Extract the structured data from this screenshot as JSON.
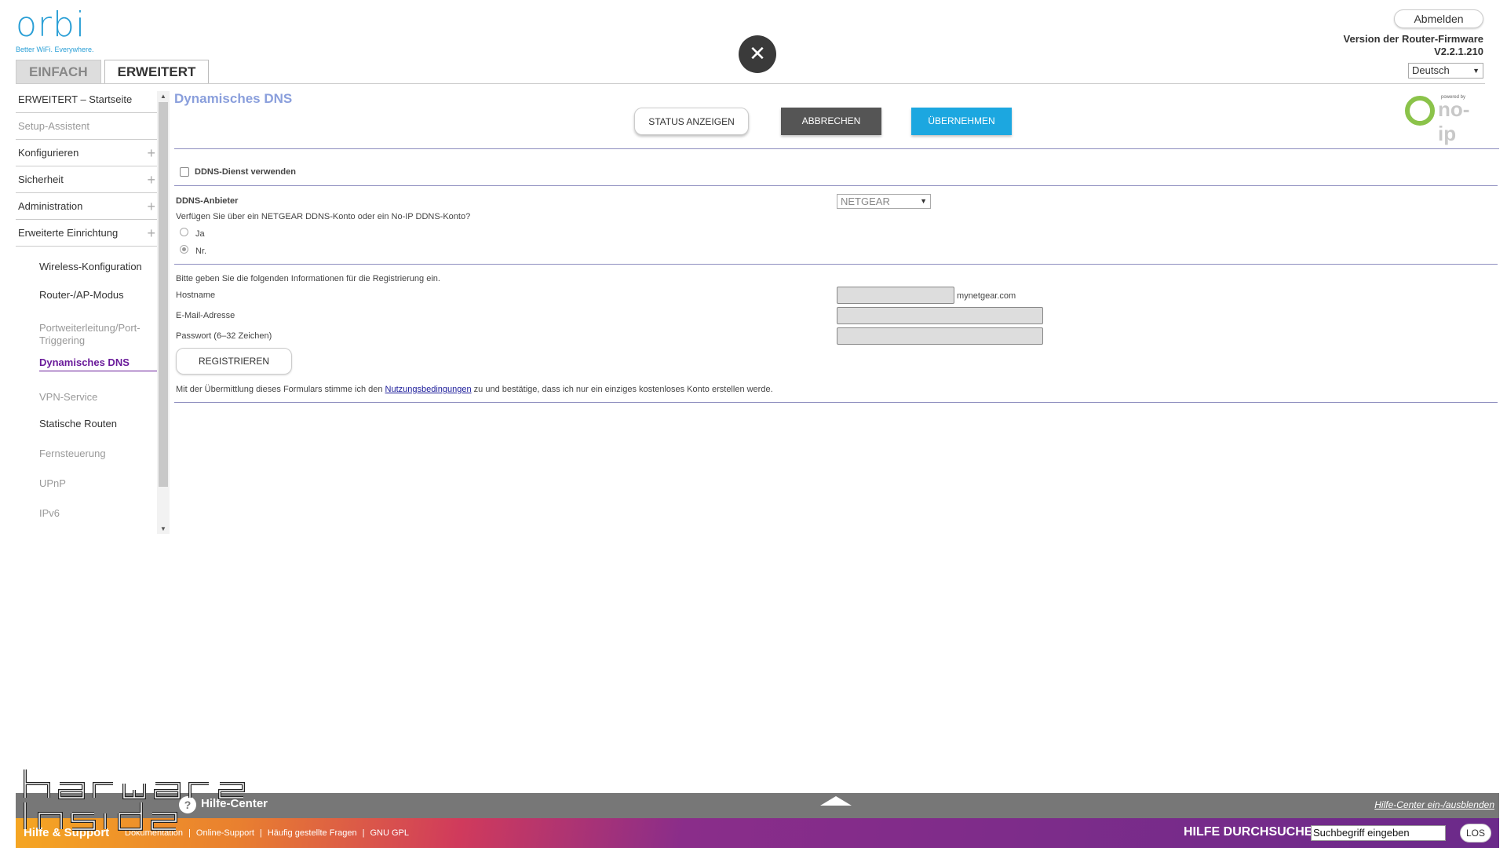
{
  "header": {
    "logo_word": "orbi",
    "logo_tagline": "Better WiFi. Everywhere.",
    "tabs": [
      {
        "label": "EINFACH",
        "active": false
      },
      {
        "label": "ERWEITERT",
        "active": true
      }
    ],
    "close_symbol": "✕",
    "logout_label": "Abmelden",
    "firmware_label": "Version der Router-Firmware",
    "firmware_version": "V2.2.1.210",
    "language": "Deutsch"
  },
  "sidebar": {
    "items": [
      {
        "label": "ERWEITERT – Startseite",
        "muted": false
      },
      {
        "label": "Setup-Assistent",
        "muted": true
      },
      {
        "label": "Konfigurieren",
        "expand": "+"
      },
      {
        "label": "Sicherheit",
        "expand": "+"
      },
      {
        "label": "Administration",
        "expand": "+"
      },
      {
        "label": "Erweiterte Einrichtung",
        "expand": "+"
      }
    ],
    "sub_items": [
      {
        "label": "Wireless-Konfiguration",
        "state": "normal"
      },
      {
        "label": "Router-/AP-Modus",
        "state": "normal"
      },
      {
        "label": "Portweiterleitung/Port-Triggering",
        "state": "muted"
      },
      {
        "label": "Dynamisches DNS",
        "state": "active"
      },
      {
        "label": "VPN-Service",
        "state": "muted"
      },
      {
        "label": "Statische Routen",
        "state": "normal"
      },
      {
        "label": "Fernsteuerung",
        "state": "muted"
      },
      {
        "label": "UPnP",
        "state": "muted"
      },
      {
        "label": "IPv6",
        "state": "muted"
      }
    ]
  },
  "main": {
    "title": "Dynamisches DNS",
    "buttons": {
      "status": "STATUS ANZEIGEN",
      "cancel": "ABBRECHEN",
      "apply": "ÜBERNEHMEN"
    },
    "noip_powered": "powered by",
    "noip_text": "no-ip",
    "use_ddns_label": "DDNS-Dienst verwenden",
    "use_ddns_checked": false,
    "provider_label": "DDNS-Anbieter",
    "provider_value": "NETGEAR",
    "account_question": "Verfügen Sie über ein NETGEAR DDNS-Konto oder ein No-IP DDNS-Konto?",
    "radio_yes": "Ja",
    "radio_no": "Nr.",
    "selected_radio": "Nr.",
    "register_info": "Bitte geben Sie die folgenden Informationen für die Registrierung ein.",
    "hostname_label": "Hostname",
    "hostname_suffix": "mynetgear.com",
    "email_label": "E-Mail-Adresse",
    "password_label": "Passwort (6–32 Zeichen)",
    "register_button": "REGISTRIEREN",
    "terms_prefix": "Mit der Übermittlung dieses Formulars stimme ich den ",
    "terms_link": "Nutzungsbedingungen",
    "terms_suffix": " zu und bestätige, dass ich nur ein einziges kostenloses Konto erstellen werde."
  },
  "footer": {
    "help_center_title": "Hilfe-Center",
    "help_center_toggle": "Hilfe-Center ein-/ausblenden",
    "support_title": "Hilfe & Support",
    "support_links": [
      "Dokumentation",
      "Online-Support",
      "Häufig gestellte Fragen",
      "GNU GPL"
    ],
    "search_label": "HILFE DURCHSUCHEN",
    "search_placeholder": "Suchbegriff eingeben",
    "search_button": "LOS"
  },
  "watermark": "hardware inside",
  "colors": {
    "accent_blue": "#1ca7e0",
    "title_purple": "#8a9fdc",
    "active_nav": "#6a1b9a",
    "cancel_gray": "#555555"
  }
}
